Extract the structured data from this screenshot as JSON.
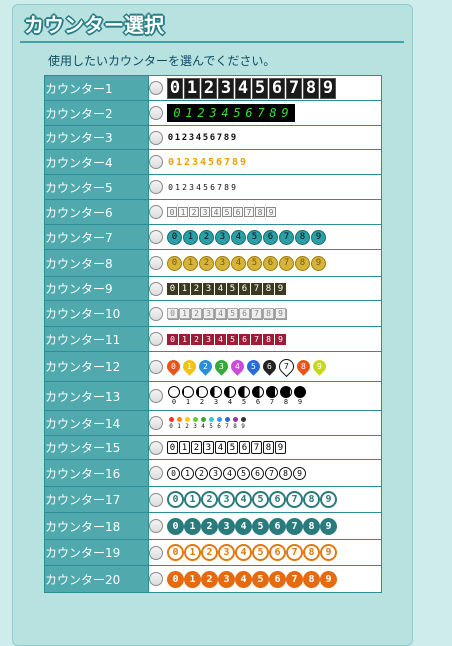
{
  "title": "カウンター選択",
  "instruction": "使用したいカウンターを選んでください。",
  "digits": [
    "0",
    "1",
    "2",
    "3",
    "4",
    "5",
    "6",
    "7",
    "8",
    "9"
  ],
  "colors": {
    "panel_bg": "#b8e2e0",
    "label_bg": "#4fa9ad",
    "border": "#2f8e95",
    "teal": "#2a7b7e",
    "orange": "#e66a10"
  },
  "counters": [
    {
      "label": "カウンター1",
      "style": "s1"
    },
    {
      "label": "カウンター2",
      "style": "s2"
    },
    {
      "label": "カウンター3",
      "style": "s3"
    },
    {
      "label": "カウンター4",
      "style": "s4"
    },
    {
      "label": "カウンター5",
      "style": "s5"
    },
    {
      "label": "カウンター6",
      "style": "s6"
    },
    {
      "label": "カウンター7",
      "style": "s7"
    },
    {
      "label": "カウンター8",
      "style": "s8"
    },
    {
      "label": "カウンター9",
      "style": "s9"
    },
    {
      "label": "カウンター10",
      "style": "s10"
    },
    {
      "label": "カウンター11",
      "style": "s11"
    },
    {
      "label": "カウンター12",
      "style": "s12"
    },
    {
      "label": "カウンター13",
      "style": "s13"
    },
    {
      "label": "カウンター14",
      "style": "s14"
    },
    {
      "label": "カウンター15",
      "style": "s15"
    },
    {
      "label": "カウンター16",
      "style": "s16"
    },
    {
      "label": "カウンター17",
      "style": "s17"
    },
    {
      "label": "カウンター18",
      "style": "s18"
    },
    {
      "label": "カウンター19",
      "style": "s19"
    },
    {
      "label": "カウンター20",
      "style": "s20"
    }
  ],
  "pin_colors": [
    "#e8541a",
    "#f2c21b",
    "#2a8ed8",
    "#37a83c",
    "#c94bd6",
    "#2a6bd8",
    "#222222",
    "#ffffff",
    "#e8541a",
    "#c7d81e"
  ],
  "dot_colors": [
    "#e33",
    "#f80",
    "#fc0",
    "#6c3",
    "#3a3",
    "#3cc",
    "#39f",
    "#36c",
    "#939",
    "#333"
  ]
}
